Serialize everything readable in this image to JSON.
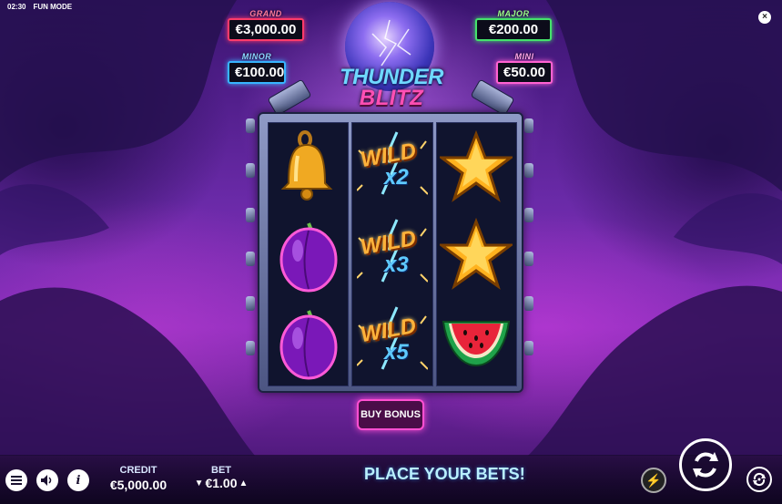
{
  "status": {
    "time": "02:30",
    "mode": "FUN MODE"
  },
  "jackpots": {
    "grand": {
      "label": "GRAND",
      "value": "€3,000.00",
      "color": "#ff3b6a"
    },
    "major": {
      "label": "MAJOR",
      "value": "€200.00",
      "color": "#44e26b"
    },
    "minor": {
      "label": "MINOR",
      "value": "€100.00",
      "color": "#38b4ff"
    },
    "mini": {
      "label": "MINI",
      "value": "€50.00",
      "color": "#ff62d2"
    }
  },
  "logo": {
    "line1": "THUNDER",
    "line2": "BLITZ"
  },
  "reels": [
    [
      "bell-icon",
      "plum-icon",
      "plum-icon"
    ],
    [
      {
        "symbol": "WILD",
        "multiplier": "x2"
      },
      {
        "symbol": "WILD",
        "multiplier": "x3"
      },
      {
        "symbol": "WILD",
        "multiplier": "x5"
      }
    ],
    [
      "star-icon",
      "star-icon",
      "watermelon-icon"
    ]
  ],
  "buy_bonus_label": "BUY BONUS",
  "bottom": {
    "credit_label": "CREDIT",
    "credit_value": "€5,000.00",
    "bet_label": "BET",
    "bet_value": "€1.00",
    "message": "PLACE YOUR BETS!"
  },
  "icons": {
    "menu": "menu-icon",
    "sound": "sound-icon",
    "info": "info-icon",
    "turbo": "turbo-off-icon",
    "spin": "spin-icon",
    "autoplay": "autoplay-icon"
  }
}
